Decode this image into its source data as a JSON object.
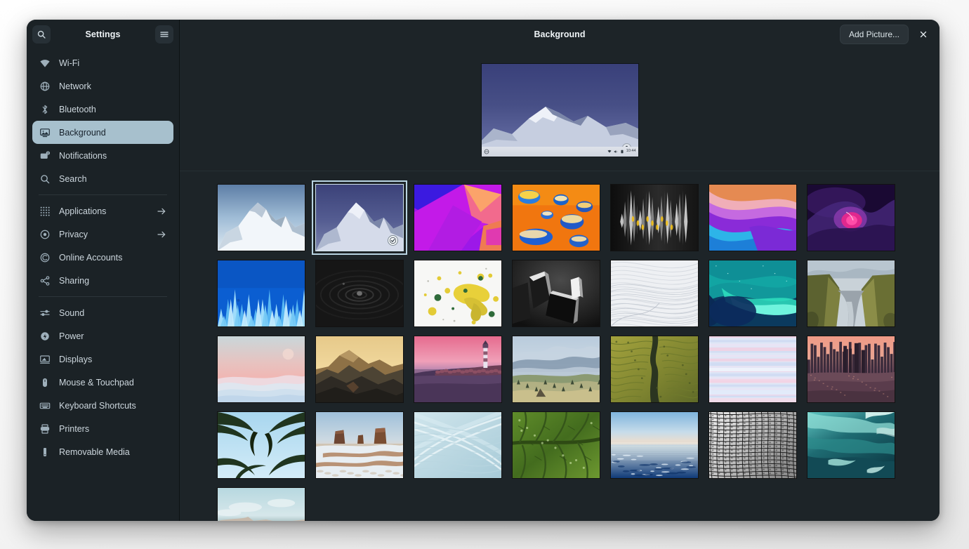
{
  "window": {
    "sidebar": {
      "title": "Settings",
      "search_icon": "search-icon",
      "menu_icon": "hamburger-menu-icon",
      "items": [
        {
          "label": "Wi-Fi",
          "icon": "wifi-icon",
          "selected": false,
          "arrow": false
        },
        {
          "label": "Network",
          "icon": "network-globe-icon",
          "selected": false,
          "arrow": false
        },
        {
          "label": "Bluetooth",
          "icon": "bluetooth-icon",
          "selected": false,
          "arrow": false
        },
        {
          "label": "Background",
          "icon": "background-monitor-icon",
          "selected": true,
          "arrow": false
        },
        {
          "label": "Notifications",
          "icon": "notifications-icon",
          "selected": false,
          "arrow": false
        },
        {
          "label": "Search",
          "icon": "search-icon",
          "selected": false,
          "arrow": false
        },
        {
          "separator": true
        },
        {
          "label": "Applications",
          "icon": "applications-grid-icon",
          "selected": false,
          "arrow": true
        },
        {
          "label": "Privacy",
          "icon": "privacy-eye-icon",
          "selected": false,
          "arrow": true
        },
        {
          "label": "Online Accounts",
          "icon": "online-accounts-icon",
          "selected": false,
          "arrow": false
        },
        {
          "label": "Sharing",
          "icon": "sharing-icon",
          "selected": false,
          "arrow": false
        },
        {
          "separator": true
        },
        {
          "label": "Sound",
          "icon": "sound-sliders-icon",
          "selected": false,
          "arrow": false
        },
        {
          "label": "Power",
          "icon": "power-bolt-icon",
          "selected": false,
          "arrow": false
        },
        {
          "label": "Displays",
          "icon": "displays-icon",
          "selected": false,
          "arrow": false
        },
        {
          "label": "Mouse & Touchpad",
          "icon": "mouse-icon",
          "selected": false,
          "arrow": false
        },
        {
          "label": "Keyboard Shortcuts",
          "icon": "keyboard-icon",
          "selected": false,
          "arrow": false
        },
        {
          "label": "Printers",
          "icon": "printer-icon",
          "selected": false,
          "arrow": false
        },
        {
          "label": "Removable Media",
          "icon": "removable-media-icon",
          "selected": false,
          "arrow": false
        }
      ]
    },
    "header": {
      "title": "Background",
      "add_picture_label": "Add Picture...",
      "close_icon": "close-icon"
    },
    "preview": {
      "name": "current-background-preview",
      "description": "snowy mountain peak under deep blue sky with desktop panel",
      "panel_clock": "10:44",
      "panel_icons": [
        "wifi-icon",
        "volume-icon",
        "battery-icon"
      ],
      "panel_left_icon": "activities-icon"
    },
    "wallpapers": [
      {
        "name": "mountain-daylight",
        "description": "snowy mountain peak, pale blue sky",
        "selected": false
      },
      {
        "name": "mountain-dusk",
        "description": "snowy mountain peak, deep blue dusk sky",
        "selected": true
      },
      {
        "name": "abstract-magenta-shards",
        "description": "magenta and blue geometric shards",
        "selected": false
      },
      {
        "name": "orange-droplets",
        "description": "iridescent water droplets on orange",
        "selected": false
      },
      {
        "name": "dark-spikes",
        "description": "dark metallic spikes with gold highlights",
        "selected": false
      },
      {
        "name": "purple-cyan-waves",
        "description": "purple and cyan flowing waves",
        "selected": false
      },
      {
        "name": "purple-pink-glow",
        "description": "dark purple with magenta glow",
        "selected": false
      },
      {
        "name": "blue-crystal-spikes",
        "description": "blue crystal spikes on deep blue",
        "selected": false
      },
      {
        "name": "black-ripple",
        "description": "black water ripple with droplet",
        "selected": false
      },
      {
        "name": "yellow-paint-splash",
        "description": "yellow paint splash on white",
        "selected": false
      },
      {
        "name": "bw-geometric-blocks",
        "description": "black and white geometric blocks",
        "selected": false
      },
      {
        "name": "white-wave-lines",
        "description": "white abstract wave lines",
        "selected": false
      },
      {
        "name": "teal-aurora",
        "description": "teal aurora swirl on navy",
        "selected": false
      },
      {
        "name": "green-canyon",
        "description": "mossy canyon with river",
        "selected": false
      },
      {
        "name": "pink-dunes",
        "description": "pink sky over pale dunes",
        "selected": false
      },
      {
        "name": "mountain-sunset",
        "description": "mountain silhouette at golden sunset",
        "selected": false
      },
      {
        "name": "pink-lighthouse",
        "description": "lighthouse on jetty under pink sky",
        "selected": false
      },
      {
        "name": "misty-valley",
        "description": "misty valley at dawn",
        "selected": false
      },
      {
        "name": "green-river-delta",
        "description": "aerial green river delta",
        "selected": false
      },
      {
        "name": "pastel-clouds",
        "description": "pastel pink and blue striped clouds",
        "selected": false
      },
      {
        "name": "city-skyline-dusk",
        "description": "city skyline at pink dusk",
        "selected": false
      },
      {
        "name": "palm-fronds",
        "description": "palm fronds against pale blue sky",
        "selected": false
      },
      {
        "name": "snowy-monument-valley",
        "description": "snow covered desert buttes",
        "selected": false
      },
      {
        "name": "light-blue-curves",
        "description": "light blue abstract curves",
        "selected": false
      },
      {
        "name": "green-leaf-macro",
        "description": "green leaf veins macro",
        "selected": false
      },
      {
        "name": "blue-ocean-horizon",
        "description": "blue ocean and horizon",
        "selected": false
      },
      {
        "name": "gray-facade-pattern",
        "description": "gray architectural scale pattern",
        "selected": false
      },
      {
        "name": "teal-ice-cave",
        "description": "teal glacial ice formation",
        "selected": false
      },
      {
        "name": "coastal-beach",
        "description": "pale coastal beach with cliffs",
        "selected": false
      }
    ]
  },
  "colors": {
    "window_bg": "#1d2428",
    "sidebar_bg": "#1b2226",
    "selected_row": "#a7c0cd",
    "text_primary": "#eef3f6",
    "text_secondary": "#ccd6dd",
    "button_bg": "#2a3237",
    "selection_outline": "#b8d4e2"
  }
}
